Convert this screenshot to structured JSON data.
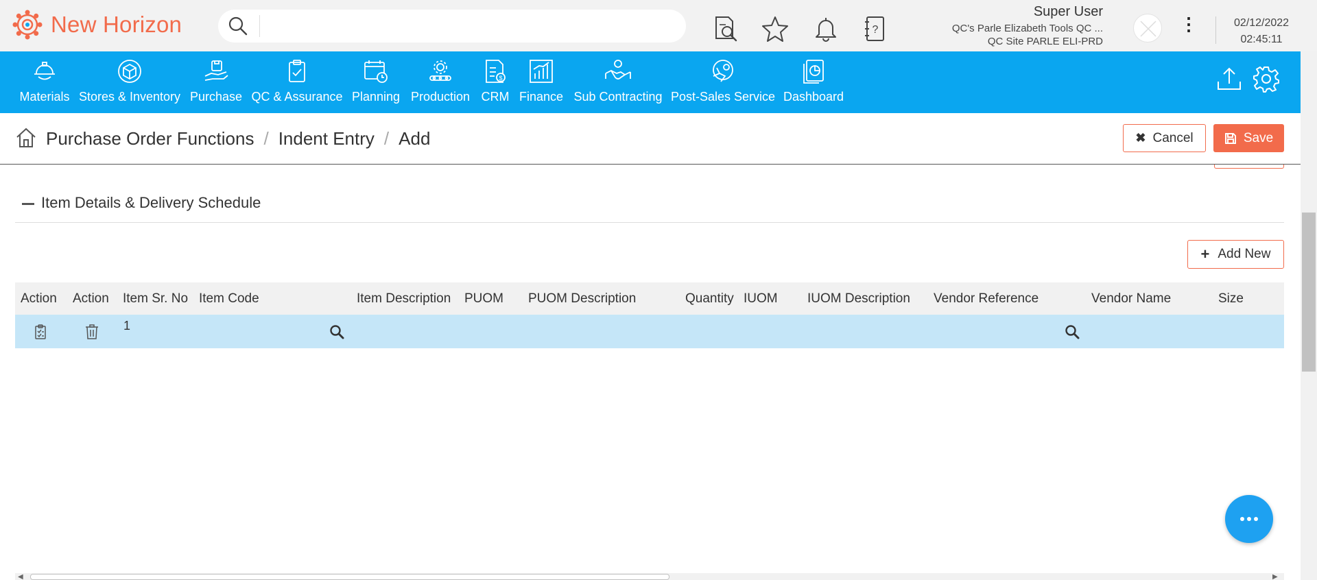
{
  "app": {
    "name": "New Horizon",
    "brand_color": "#f26b4b",
    "nav_color": "#0aa6f0"
  },
  "header": {
    "search": {
      "placeholder": "",
      "value": ""
    },
    "icons": [
      "document-search-icon",
      "star-icon",
      "bell-icon",
      "help-book-icon"
    ],
    "user": {
      "name": "Super User",
      "org": "QC's Parle Elizabeth Tools QC ...",
      "site": "QC Site PARLE ELI-PRD"
    },
    "date": "02/12/2022",
    "time": "02:45:11"
  },
  "modules": [
    {
      "label": "Materials",
      "icon": "helmet-icon"
    },
    {
      "label": "Stores & Inventory",
      "icon": "box-icon"
    },
    {
      "label": "Purchase",
      "icon": "hand-bag-icon"
    },
    {
      "label": "QC & Assurance",
      "icon": "clipboard-check-icon"
    },
    {
      "label": "Planning",
      "icon": "calendar-clock-icon"
    },
    {
      "label": "Production",
      "icon": "gear-conveyor-icon"
    },
    {
      "label": "CRM",
      "icon": "invoice-icon"
    },
    {
      "label": "Finance",
      "icon": "bar-chart-icon"
    },
    {
      "label": "Sub Contracting",
      "icon": "handshake-icon"
    },
    {
      "label": "Post-Sales Service",
      "icon": "service-icon"
    },
    {
      "label": "Dashboard",
      "icon": "pie-document-icon"
    }
  ],
  "breadcrumb": {
    "items": [
      "Purchase Order Functions",
      "Indent Entry",
      "Add"
    ]
  },
  "actions": {
    "cancel_label": "Cancel",
    "save_label": "Save"
  },
  "section": {
    "title": "Item Details & Delivery Schedule",
    "add_new_label": "Add New"
  },
  "table": {
    "columns": [
      "Action",
      "Action",
      "Item Sr. No",
      "Item Code",
      "Item Description",
      "PUOM",
      "PUOM Description",
      "Quantity",
      "IUOM",
      "IUOM Description",
      "Vendor Reference",
      "Vendor Name",
      "Size"
    ],
    "rows": [
      {
        "sr_no": "1",
        "item_code": "",
        "item_description": "",
        "puom": "",
        "puom_description": "",
        "quantity": "",
        "iuom": "",
        "iuom_description": "",
        "vendor_reference": "",
        "vendor_name": "",
        "size": ""
      }
    ],
    "selected_row_color": "#c5e6f8"
  }
}
